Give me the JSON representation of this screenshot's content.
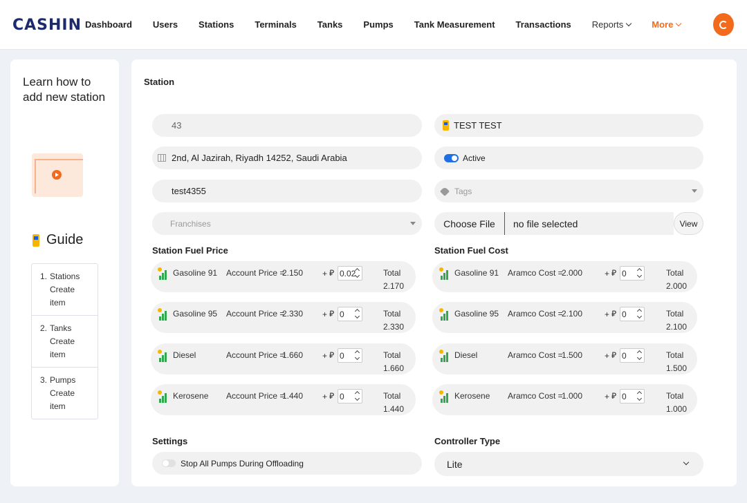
{
  "brand": {
    "logo_text": "CASHIN",
    "accent": "#f26b1d",
    "primary": "#1e2a6e"
  },
  "nav": {
    "items": [
      "Dashboard",
      "Users",
      "Stations",
      "Terminals",
      "Tanks",
      "Pumps",
      "Tank Measurement",
      "Transactions"
    ],
    "reports": "Reports",
    "more": "More"
  },
  "guide": {
    "learn_title": "Learn how to add new station",
    "heading": "Guide",
    "steps": [
      {
        "num": "1.",
        "title": "Stations",
        "sub": "Create item"
      },
      {
        "num": "2.",
        "title": "Tanks",
        "sub": "Create item"
      },
      {
        "num": "3.",
        "title": "Pumps",
        "sub": "Create item"
      }
    ]
  },
  "station": {
    "title": "Station",
    "id_value": "43",
    "name_value": "TEST TEST",
    "address_value": "2nd, Al Jazirah, Riyadh 14252, Saudi Arabia",
    "status_label": "Active",
    "code_value": "test4355",
    "tags_placeholder": "Tags",
    "franchises_placeholder": "Franchises",
    "choose_file_label": "Choose File",
    "file_status": "no file selected",
    "view_label": "View"
  },
  "fuel_price": {
    "title": "Station Fuel Price",
    "price_label": "Account Price =",
    "rows": [
      {
        "name": "Gasoline 91",
        "price": "2.150",
        "adjust": "0.02",
        "total": "2.170"
      },
      {
        "name": "Gasoline 95",
        "price": "2.330",
        "adjust": "0",
        "total": "2.330"
      },
      {
        "name": "Diesel",
        "price": "1.660",
        "adjust": "0",
        "total": "1.660"
      },
      {
        "name": "Kerosene",
        "price": "1.440",
        "adjust": "0",
        "total": "1.440"
      }
    ]
  },
  "fuel_cost": {
    "title": "Station Fuel Cost",
    "price_label": "Aramco Cost =",
    "rows": [
      {
        "name": "Gasoline 91",
        "price": "2.000",
        "adjust": "0",
        "total": "2.000"
      },
      {
        "name": "Gasoline 95",
        "price": "2.100",
        "adjust": "0",
        "total": "2.100"
      },
      {
        "name": "Diesel",
        "price": "1.500",
        "adjust": "0",
        "total": "1.500"
      },
      {
        "name": "Kerosene",
        "price": "1.000",
        "adjust": "0",
        "total": "1.000"
      }
    ]
  },
  "common": {
    "plus": "+",
    "riyal": "⃁",
    "total_label": "Total"
  },
  "settings": {
    "title": "Settings",
    "stop_pumps_label": "Stop All Pumps During Offloading"
  },
  "controller": {
    "title": "Controller Type",
    "value": "Lite"
  }
}
